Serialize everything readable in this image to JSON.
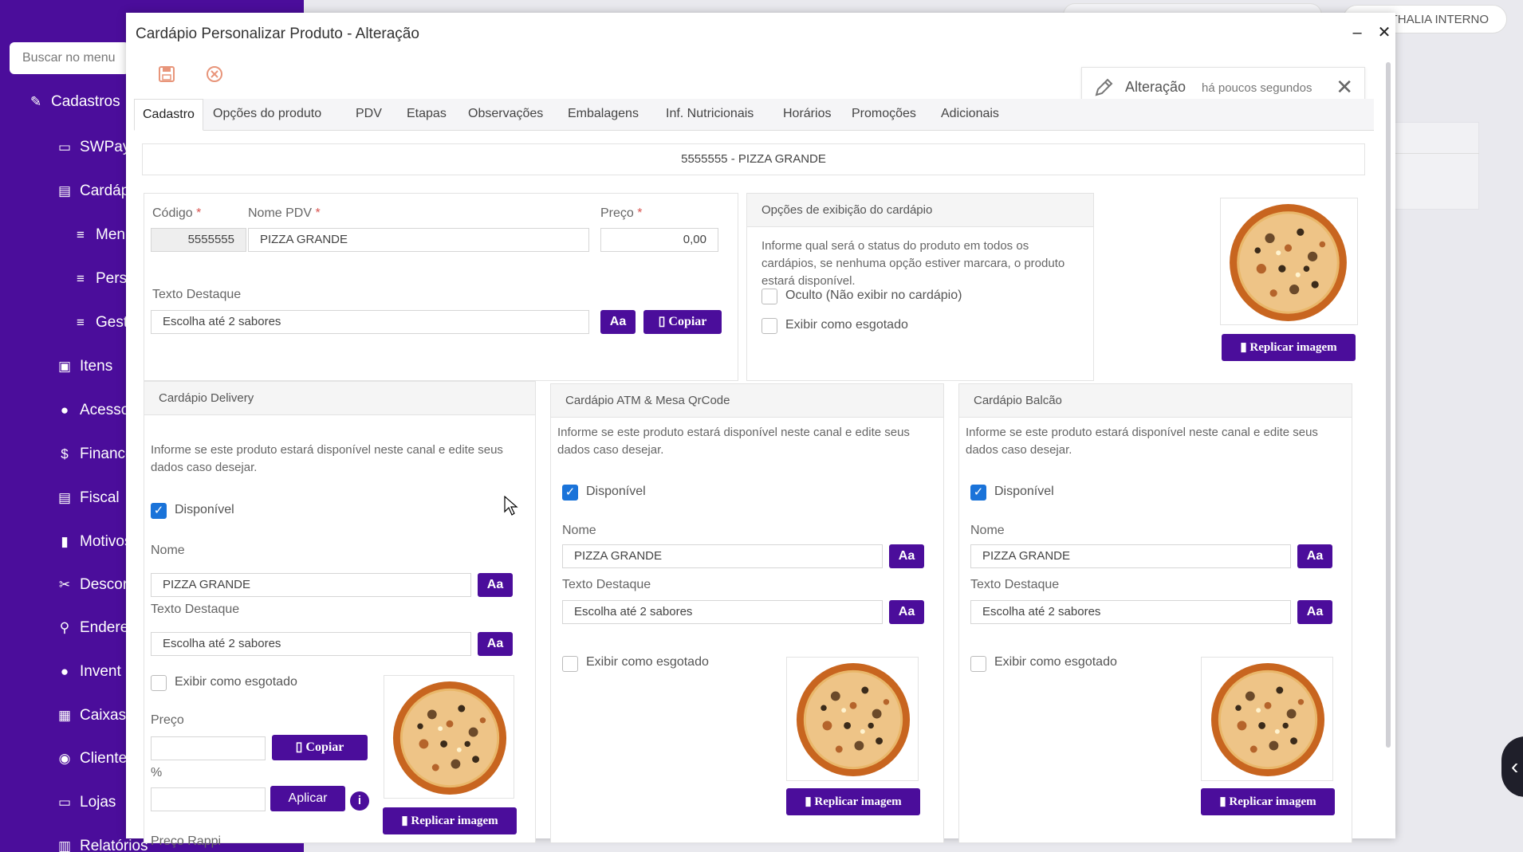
{
  "app": {
    "search_placeholder": "Buscar no menu",
    "user_name": "ATHALIA INTERNO",
    "sidebar": [
      {
        "label": "Cadastros",
        "icon": "edit-icon"
      },
      {
        "label": "SWPay",
        "icon": "card-icon"
      },
      {
        "label": "Cardáp",
        "icon": "clipboard-icon"
      },
      {
        "label": "Men",
        "icon": "list-icon"
      },
      {
        "label": "Pers",
        "icon": "list-icon"
      },
      {
        "label": "Gest",
        "icon": "list-icon"
      },
      {
        "label": "Itens",
        "icon": "box-icon"
      },
      {
        "label": "Acesso",
        "icon": "user-icon"
      },
      {
        "label": "Finance",
        "icon": "dollar-icon"
      },
      {
        "label": "Fiscal",
        "icon": "document-icon"
      },
      {
        "label": "Motivos",
        "icon": "bookmark-icon"
      },
      {
        "label": "Descor",
        "icon": "scissors-icon"
      },
      {
        "label": "Endere",
        "icon": "pin-icon"
      },
      {
        "label": "Invent",
        "icon": "user-edit-icon"
      },
      {
        "label": "Caixas",
        "icon": "register-icon"
      },
      {
        "label": "Cliente",
        "icon": "client-icon"
      },
      {
        "label": "Lojas",
        "icon": "store-icon"
      },
      {
        "label": "Relatórios",
        "icon": "chart-icon"
      }
    ]
  },
  "modal": {
    "title": "Cardápio Personalizar Produto - Alteração",
    "notification": {
      "text": "Alteração",
      "time": "há poucos segundos"
    },
    "tabs": [
      "Cadastro",
      "Opções do produto",
      "PDV",
      "Etapas",
      "Observações",
      "Embalagens",
      "Inf. Nutricionais",
      "Horários",
      "Promoções",
      "Adicionais"
    ],
    "product_header": "5555555 - PIZZA GRANDE",
    "main": {
      "codigo_label": "Código",
      "codigo_value": "5555555",
      "nome_label": "Nome PDV",
      "nome_value": "PIZZA GRANDE",
      "preco_label": "Preço",
      "preco_value": "0,00",
      "required_mark": "*",
      "texto_label": "Texto Destaque",
      "texto_value": "Escolha até 2 sabores",
      "aa_label": "Aa",
      "copiar_label": "Copiar"
    },
    "exibicao": {
      "title": "Opções de exibição do cardápio",
      "help": "Informe qual será o status do produto em todos os cardápios, se nenhuma opção estiver marcara, o produto estará disponível.",
      "oculto_label": "Oculto (Não exibir no cardápio)",
      "esgotado_label": "Exibir como esgotado",
      "replicar_label": "Replicar imagem"
    },
    "delivery": {
      "title": "Cardápio Delivery",
      "help": "Informe se este produto estará disponível neste canal e edite seus dados caso desejar.",
      "disponivel_label": "Disponível",
      "nome_label": "Nome",
      "nome_value": "PIZZA GRANDE",
      "texto_label": "Texto Destaque",
      "texto_value": "Escolha até 2 sabores",
      "esgotado_label": "Exibir como esgotado",
      "preco_label": "Preço",
      "copiar_label": "Copiar",
      "percent_label": "%",
      "aplicar_label": "Aplicar",
      "preco_rappi_label": "Preço Rappi",
      "replicar_label": "Replicar imagem",
      "aa_label": "Aa"
    },
    "atm": {
      "title": "Cardápio ATM & Mesa QrCode",
      "help": "Informe se este produto estará disponível neste canal e edite seus dados caso desejar.",
      "disponivel_label": "Disponível",
      "nome_label": "Nome",
      "nome_value": "PIZZA GRANDE",
      "texto_label": "Texto Destaque",
      "texto_value": "Escolha até 2 sabores",
      "esgotado_label": "Exibir como esgotado",
      "replicar_label": "Replicar imagem",
      "aa_label": "Aa"
    },
    "balcao": {
      "title": "Cardápio Balcão",
      "help": "Informe se este produto estará disponível neste canal e edite seus dados caso desejar.",
      "disponivel_label": "Disponível",
      "nome_label": "Nome",
      "nome_value": "PIZZA GRANDE",
      "texto_label": "Texto Destaque",
      "texto_value": "Escolha até 2 sabores",
      "esgotado_label": "Exibir como esgotado",
      "replicar_label": "Replicar imagem",
      "aa_label": "Aa"
    }
  },
  "colors": {
    "brand": "#4b0d9b",
    "check": "#1a73d9",
    "required": "#d9534f"
  }
}
